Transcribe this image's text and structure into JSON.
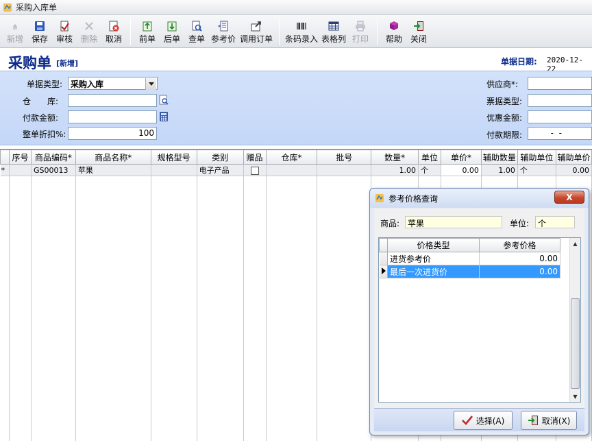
{
  "window": {
    "title": "采购入库单"
  },
  "toolbar": {
    "items": [
      {
        "label": "新增",
        "icon": "new-icon",
        "enabled": false
      },
      {
        "label": "保存",
        "icon": "save-icon",
        "enabled": true
      },
      {
        "label": "审核",
        "icon": "audit-icon",
        "enabled": true
      },
      {
        "label": "删除",
        "icon": "delete-icon",
        "enabled": false
      },
      {
        "label": "取消",
        "icon": "cancel-icon",
        "enabled": true
      },
      {
        "label": "前单",
        "icon": "prev-doc-icon",
        "enabled": true
      },
      {
        "label": "后单",
        "icon": "next-doc-icon",
        "enabled": true
      },
      {
        "label": "查单",
        "icon": "search-doc-icon",
        "enabled": true
      },
      {
        "label": "参考价",
        "icon": "reference-price-icon",
        "enabled": true
      },
      {
        "label": "调用订单",
        "icon": "import-order-icon",
        "enabled": true
      },
      {
        "label": "条码录入",
        "icon": "barcode-icon",
        "enabled": true
      },
      {
        "label": "表格列",
        "icon": "table-columns-icon",
        "enabled": true
      },
      {
        "label": "打印",
        "icon": "print-icon",
        "enabled": false
      },
      {
        "label": "帮助",
        "icon": "help-book-icon",
        "enabled": true
      },
      {
        "label": "关闭",
        "icon": "exit-icon",
        "enabled": true
      }
    ]
  },
  "header": {
    "doc_title": "采购单",
    "doc_mode": "[新增]",
    "date_label": "单据日期:",
    "date_value": "2020-12-22"
  },
  "form": {
    "doc_type_label": "单据类型:",
    "doc_type_value": "采购入库",
    "warehouse_label": "仓　　库:",
    "warehouse_value": "",
    "payment_label": "付款金额:",
    "payment_value": "",
    "discount_label": "整单折扣%:",
    "discount_value": "100",
    "supplier_label": "供应商*:",
    "supplier_value": "",
    "invoice_type_label": "票据类型:",
    "invoice_type_value": "",
    "rebate_label": "优惠金额:",
    "rebate_value": "",
    "pay_term_label": "付款期限:",
    "pay_term_value": "  -  -"
  },
  "grid": {
    "columns": [
      "序号",
      "商品编码*",
      "商品名称*",
      "规格型号",
      "类别",
      "赠品",
      "仓库*",
      "批号",
      "数量*",
      "单位",
      "单价*",
      "辅助数量",
      "辅助单位",
      "辅助单价"
    ],
    "rows": [
      {
        "marker": "*",
        "seq": "",
        "code": "GS00013",
        "name": "苹果",
        "spec": "",
        "category": "电子产品",
        "gift": false,
        "warehouse": "",
        "batch": "",
        "qty": "1.00",
        "unit": "个",
        "price": "0.00",
        "aux_qty": "1.00",
        "aux_unit": "个",
        "aux_price": "0.00"
      }
    ]
  },
  "dialog": {
    "title": "参考价格查询",
    "product_label": "商品:",
    "product_value": "苹果",
    "unit_label": "单位:",
    "unit_value": "个",
    "columns": [
      "价格类型",
      "参考价格"
    ],
    "rows": [
      {
        "type": "进货参考价",
        "price": "0.00",
        "selected": false
      },
      {
        "type": "最后一次进货价",
        "price": "0.00",
        "selected": true
      }
    ],
    "ok_label": "选择(A)",
    "cancel_label": "取消(X)",
    "close_label": "X"
  }
}
